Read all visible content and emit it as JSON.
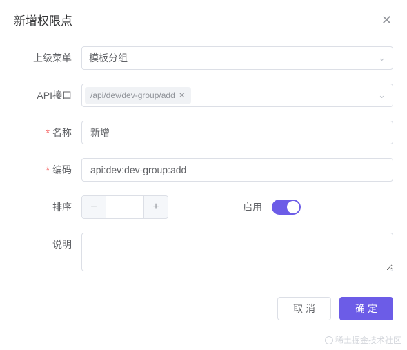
{
  "dialog": {
    "title": "新增权限点"
  },
  "form": {
    "parentMenu": {
      "label": "上级菜单",
      "value": "模板分组"
    },
    "api": {
      "label": "API接口",
      "tags": [
        "/api/dev/dev-group/add"
      ]
    },
    "name": {
      "label": "名称",
      "value": "新增"
    },
    "code": {
      "label": "编码",
      "value": "api:dev:dev-group:add"
    },
    "sort": {
      "label": "排序",
      "value": ""
    },
    "enable": {
      "label": "启用",
      "value": true
    },
    "desc": {
      "label": "说明",
      "value": ""
    }
  },
  "footer": {
    "cancel": "取消",
    "confirm": "确定"
  },
  "watermark": "稀土掘金技术社区",
  "colors": {
    "primary": "#6c5ce7"
  }
}
